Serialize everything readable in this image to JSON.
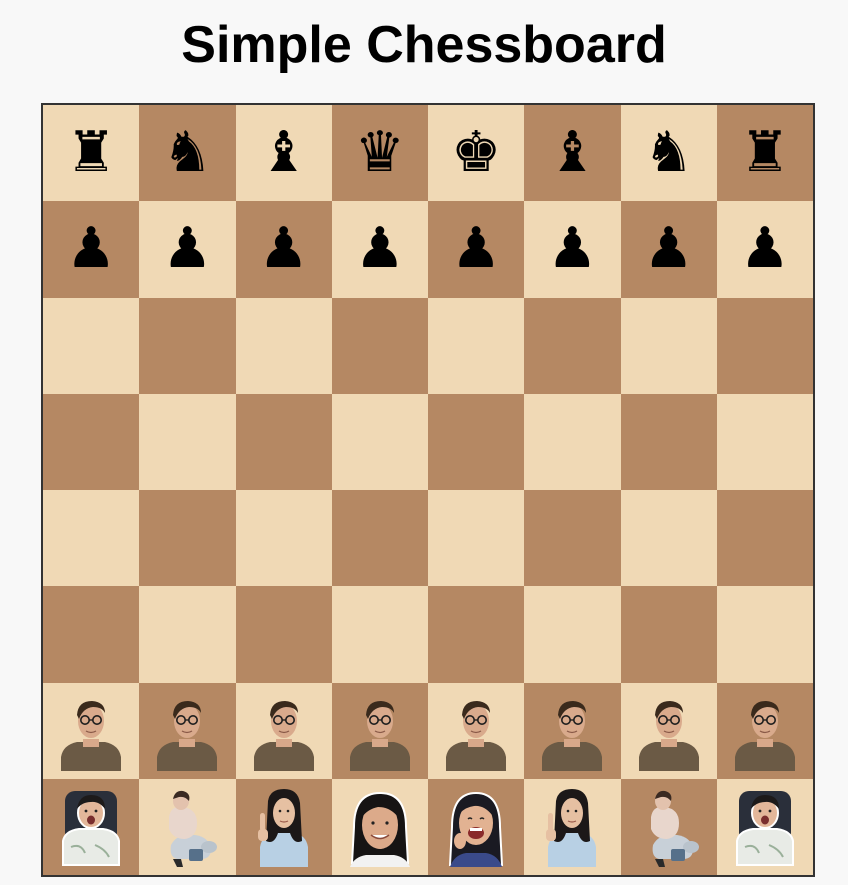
{
  "title": "Simple Chessboard",
  "colors": {
    "light": "#f0d9b5",
    "dark": "#b58863",
    "background": "#f8f8f8",
    "border": "#333333"
  },
  "board": {
    "rows": [
      [
        {
          "piece": "rook",
          "side": "black",
          "glyph": "♜",
          "icon": "black-rook-icon"
        },
        {
          "piece": "knight",
          "side": "black",
          "glyph": "♞",
          "icon": "black-knight-icon"
        },
        {
          "piece": "bishop",
          "side": "black",
          "glyph": "♝",
          "icon": "black-bishop-icon"
        },
        {
          "piece": "queen",
          "side": "black",
          "glyph": "♛",
          "icon": "black-queen-icon"
        },
        {
          "piece": "king",
          "side": "black",
          "glyph": "♚",
          "icon": "black-king-icon"
        },
        {
          "piece": "bishop",
          "side": "black",
          "glyph": "♝",
          "icon": "black-bishop-icon"
        },
        {
          "piece": "knight",
          "side": "black",
          "glyph": "♞",
          "icon": "black-knight-icon"
        },
        {
          "piece": "rook",
          "side": "black",
          "glyph": "♜",
          "icon": "black-rook-icon"
        }
      ],
      [
        {
          "piece": "pawn",
          "side": "black",
          "glyph": "♟",
          "icon": "black-pawn-icon"
        },
        {
          "piece": "pawn",
          "side": "black",
          "glyph": "♟",
          "icon": "black-pawn-icon"
        },
        {
          "piece": "pawn",
          "side": "black",
          "glyph": "♟",
          "icon": "black-pawn-icon"
        },
        {
          "piece": "pawn",
          "side": "black",
          "glyph": "♟",
          "icon": "black-pawn-icon"
        },
        {
          "piece": "pawn",
          "side": "black",
          "glyph": "♟",
          "icon": "black-pawn-icon"
        },
        {
          "piece": "pawn",
          "side": "black",
          "glyph": "♟",
          "icon": "black-pawn-icon"
        },
        {
          "piece": "pawn",
          "side": "black",
          "glyph": "♟",
          "icon": "black-pawn-icon"
        },
        {
          "piece": "pawn",
          "side": "black",
          "glyph": "♟",
          "icon": "black-pawn-icon"
        }
      ],
      [
        null,
        null,
        null,
        null,
        null,
        null,
        null,
        null
      ],
      [
        null,
        null,
        null,
        null,
        null,
        null,
        null,
        null
      ],
      [
        null,
        null,
        null,
        null,
        null,
        null,
        null,
        null
      ],
      [
        null,
        null,
        null,
        null,
        null,
        null,
        null,
        null
      ],
      [
        {
          "piece": "pawn",
          "side": "white",
          "photo": "man-glasses-photo"
        },
        {
          "piece": "pawn",
          "side": "white",
          "photo": "man-glasses-photo"
        },
        {
          "piece": "pawn",
          "side": "white",
          "photo": "man-glasses-photo"
        },
        {
          "piece": "pawn",
          "side": "white",
          "photo": "man-glasses-photo"
        },
        {
          "piece": "pawn",
          "side": "white",
          "photo": "man-glasses-photo"
        },
        {
          "piece": "pawn",
          "side": "white",
          "photo": "man-glasses-photo"
        },
        {
          "piece": "pawn",
          "side": "white",
          "photo": "man-glasses-photo"
        },
        {
          "piece": "pawn",
          "side": "white",
          "photo": "man-glasses-photo"
        }
      ],
      [
        {
          "piece": "rook",
          "side": "white",
          "photo": "woman-chair-photo"
        },
        {
          "piece": "knight",
          "side": "white",
          "photo": "woman-horse-photo"
        },
        {
          "piece": "bishop",
          "side": "white",
          "photo": "woman-finger-photo"
        },
        {
          "piece": "queen",
          "side": "white",
          "photo": "woman-smiling-photo"
        },
        {
          "piece": "king",
          "side": "white",
          "photo": "woman-laughing-photo"
        },
        {
          "piece": "bishop",
          "side": "white",
          "photo": "woman-finger-photo"
        },
        {
          "piece": "knight",
          "side": "white",
          "photo": "woman-horse-photo"
        },
        {
          "piece": "rook",
          "side": "white",
          "photo": "woman-chair-photo"
        }
      ]
    ]
  }
}
